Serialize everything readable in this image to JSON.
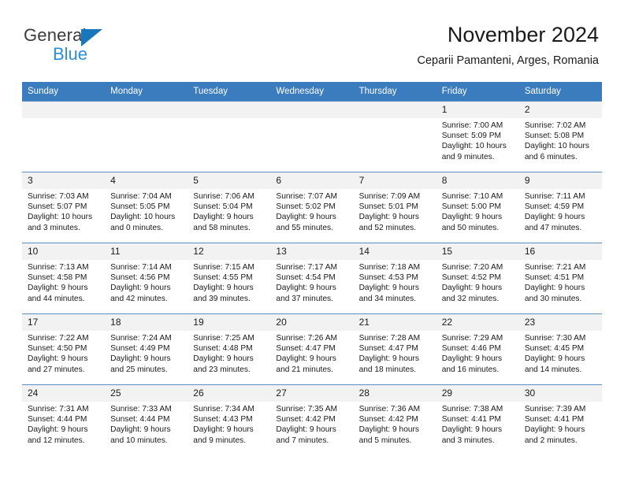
{
  "brand": {
    "word_general": "General",
    "word_blue": "Blue",
    "triangle_color": "#1876bd",
    "blue_color": "#2a8fd8"
  },
  "header": {
    "title": "November 2024",
    "subtitle": "Ceparii Pamanteni, Arges, Romania"
  },
  "theme": {
    "header_row_color": "#3b7cbf",
    "daynum_strip_color": "#f2f2f2",
    "grid_line_color": "#5b8fc4"
  },
  "weekdays": [
    "Sunday",
    "Monday",
    "Tuesday",
    "Wednesday",
    "Thursday",
    "Friday",
    "Saturday"
  ],
  "weeks": [
    [
      {
        "day": "",
        "empty": true
      },
      {
        "day": "",
        "empty": true
      },
      {
        "day": "",
        "empty": true
      },
      {
        "day": "",
        "empty": true
      },
      {
        "day": "",
        "empty": true
      },
      {
        "day": "1",
        "sunrise": "Sunrise: 7:00 AM",
        "sunset": "Sunset: 5:09 PM",
        "daylight1": "Daylight: 10 hours",
        "daylight2": "and 9 minutes."
      },
      {
        "day": "2",
        "sunrise": "Sunrise: 7:02 AM",
        "sunset": "Sunset: 5:08 PM",
        "daylight1": "Daylight: 10 hours",
        "daylight2": "and 6 minutes."
      }
    ],
    [
      {
        "day": "3",
        "sunrise": "Sunrise: 7:03 AM",
        "sunset": "Sunset: 5:07 PM",
        "daylight1": "Daylight: 10 hours",
        "daylight2": "and 3 minutes."
      },
      {
        "day": "4",
        "sunrise": "Sunrise: 7:04 AM",
        "sunset": "Sunset: 5:05 PM",
        "daylight1": "Daylight: 10 hours",
        "daylight2": "and 0 minutes."
      },
      {
        "day": "5",
        "sunrise": "Sunrise: 7:06 AM",
        "sunset": "Sunset: 5:04 PM",
        "daylight1": "Daylight: 9 hours",
        "daylight2": "and 58 minutes."
      },
      {
        "day": "6",
        "sunrise": "Sunrise: 7:07 AM",
        "sunset": "Sunset: 5:02 PM",
        "daylight1": "Daylight: 9 hours",
        "daylight2": "and 55 minutes."
      },
      {
        "day": "7",
        "sunrise": "Sunrise: 7:09 AM",
        "sunset": "Sunset: 5:01 PM",
        "daylight1": "Daylight: 9 hours",
        "daylight2": "and 52 minutes."
      },
      {
        "day": "8",
        "sunrise": "Sunrise: 7:10 AM",
        "sunset": "Sunset: 5:00 PM",
        "daylight1": "Daylight: 9 hours",
        "daylight2": "and 50 minutes."
      },
      {
        "day": "9",
        "sunrise": "Sunrise: 7:11 AM",
        "sunset": "Sunset: 4:59 PM",
        "daylight1": "Daylight: 9 hours",
        "daylight2": "and 47 minutes."
      }
    ],
    [
      {
        "day": "10",
        "sunrise": "Sunrise: 7:13 AM",
        "sunset": "Sunset: 4:58 PM",
        "daylight1": "Daylight: 9 hours",
        "daylight2": "and 44 minutes."
      },
      {
        "day": "11",
        "sunrise": "Sunrise: 7:14 AM",
        "sunset": "Sunset: 4:56 PM",
        "daylight1": "Daylight: 9 hours",
        "daylight2": "and 42 minutes."
      },
      {
        "day": "12",
        "sunrise": "Sunrise: 7:15 AM",
        "sunset": "Sunset: 4:55 PM",
        "daylight1": "Daylight: 9 hours",
        "daylight2": "and 39 minutes."
      },
      {
        "day": "13",
        "sunrise": "Sunrise: 7:17 AM",
        "sunset": "Sunset: 4:54 PM",
        "daylight1": "Daylight: 9 hours",
        "daylight2": "and 37 minutes."
      },
      {
        "day": "14",
        "sunrise": "Sunrise: 7:18 AM",
        "sunset": "Sunset: 4:53 PM",
        "daylight1": "Daylight: 9 hours",
        "daylight2": "and 34 minutes."
      },
      {
        "day": "15",
        "sunrise": "Sunrise: 7:20 AM",
        "sunset": "Sunset: 4:52 PM",
        "daylight1": "Daylight: 9 hours",
        "daylight2": "and 32 minutes."
      },
      {
        "day": "16",
        "sunrise": "Sunrise: 7:21 AM",
        "sunset": "Sunset: 4:51 PM",
        "daylight1": "Daylight: 9 hours",
        "daylight2": "and 30 minutes."
      }
    ],
    [
      {
        "day": "17",
        "sunrise": "Sunrise: 7:22 AM",
        "sunset": "Sunset: 4:50 PM",
        "daylight1": "Daylight: 9 hours",
        "daylight2": "and 27 minutes."
      },
      {
        "day": "18",
        "sunrise": "Sunrise: 7:24 AM",
        "sunset": "Sunset: 4:49 PM",
        "daylight1": "Daylight: 9 hours",
        "daylight2": "and 25 minutes."
      },
      {
        "day": "19",
        "sunrise": "Sunrise: 7:25 AM",
        "sunset": "Sunset: 4:48 PM",
        "daylight1": "Daylight: 9 hours",
        "daylight2": "and 23 minutes."
      },
      {
        "day": "20",
        "sunrise": "Sunrise: 7:26 AM",
        "sunset": "Sunset: 4:47 PM",
        "daylight1": "Daylight: 9 hours",
        "daylight2": "and 21 minutes."
      },
      {
        "day": "21",
        "sunrise": "Sunrise: 7:28 AM",
        "sunset": "Sunset: 4:47 PM",
        "daylight1": "Daylight: 9 hours",
        "daylight2": "and 18 minutes."
      },
      {
        "day": "22",
        "sunrise": "Sunrise: 7:29 AM",
        "sunset": "Sunset: 4:46 PM",
        "daylight1": "Daylight: 9 hours",
        "daylight2": "and 16 minutes."
      },
      {
        "day": "23",
        "sunrise": "Sunrise: 7:30 AM",
        "sunset": "Sunset: 4:45 PM",
        "daylight1": "Daylight: 9 hours",
        "daylight2": "and 14 minutes."
      }
    ],
    [
      {
        "day": "24",
        "sunrise": "Sunrise: 7:31 AM",
        "sunset": "Sunset: 4:44 PM",
        "daylight1": "Daylight: 9 hours",
        "daylight2": "and 12 minutes."
      },
      {
        "day": "25",
        "sunrise": "Sunrise: 7:33 AM",
        "sunset": "Sunset: 4:44 PM",
        "daylight1": "Daylight: 9 hours",
        "daylight2": "and 10 minutes."
      },
      {
        "day": "26",
        "sunrise": "Sunrise: 7:34 AM",
        "sunset": "Sunset: 4:43 PM",
        "daylight1": "Daylight: 9 hours",
        "daylight2": "and 9 minutes."
      },
      {
        "day": "27",
        "sunrise": "Sunrise: 7:35 AM",
        "sunset": "Sunset: 4:42 PM",
        "daylight1": "Daylight: 9 hours",
        "daylight2": "and 7 minutes."
      },
      {
        "day": "28",
        "sunrise": "Sunrise: 7:36 AM",
        "sunset": "Sunset: 4:42 PM",
        "daylight1": "Daylight: 9 hours",
        "daylight2": "and 5 minutes."
      },
      {
        "day": "29",
        "sunrise": "Sunrise: 7:38 AM",
        "sunset": "Sunset: 4:41 PM",
        "daylight1": "Daylight: 9 hours",
        "daylight2": "and 3 minutes."
      },
      {
        "day": "30",
        "sunrise": "Sunrise: 7:39 AM",
        "sunset": "Sunset: 4:41 PM",
        "daylight1": "Daylight: 9 hours",
        "daylight2": "and 2 minutes."
      }
    ]
  ]
}
